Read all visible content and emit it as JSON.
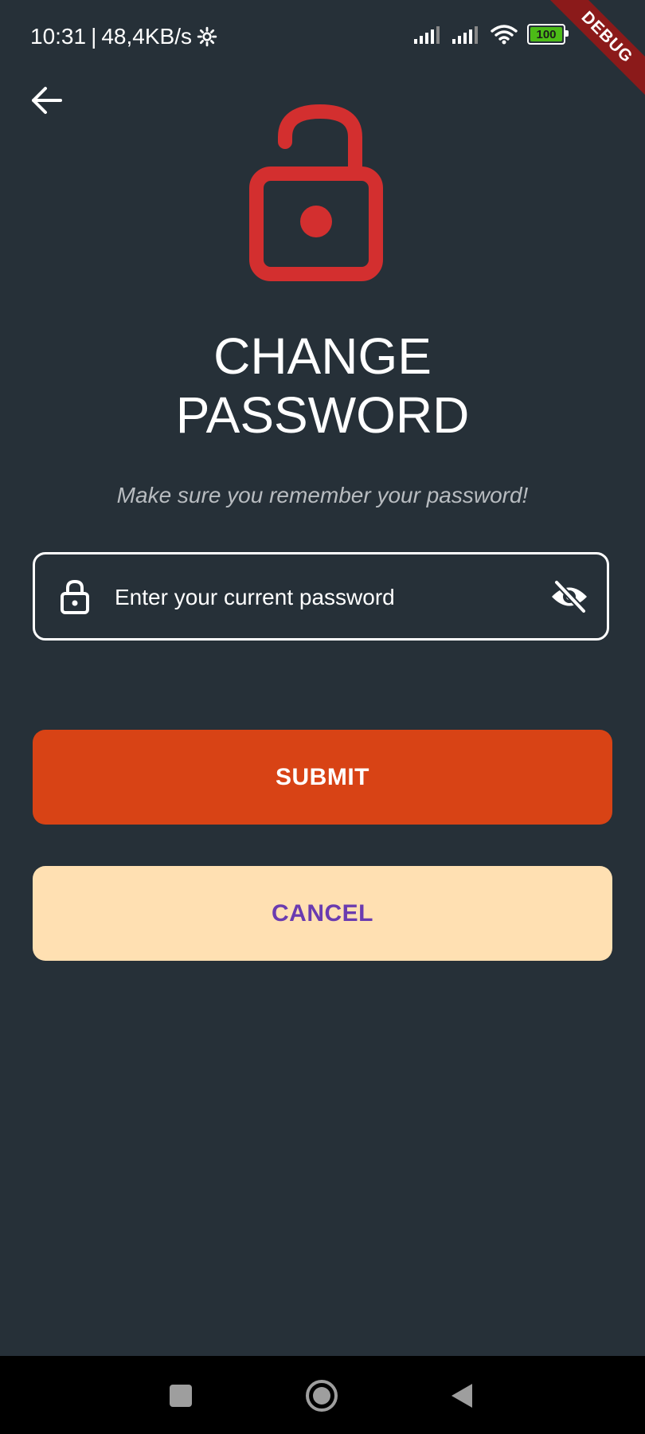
{
  "status_bar": {
    "time": "10:31",
    "separator": "|",
    "network_speed": "48,4KB/s",
    "battery_level": "100",
    "icons": [
      "gear-icon",
      "signal-icon",
      "signal-icon",
      "wifi-icon",
      "battery-icon"
    ]
  },
  "debug_banner": "DEBUG",
  "header": {
    "back_icon": "arrow-back-icon",
    "hero_icon": "lock-open-icon"
  },
  "title_line1": "CHANGE",
  "title_line2": "PASSWORD",
  "subtitle": "Make sure you remember your password!",
  "password_field": {
    "placeholder": "Enter your current password",
    "value": "",
    "leading_icon": "lock-open-icon",
    "trailing_icon": "eye-off-icon"
  },
  "buttons": {
    "submit_label": "SUBMIT",
    "cancel_label": "CANCEL"
  },
  "navigation_bar": {
    "icons": [
      "recents-square-icon",
      "home-circle-icon",
      "back-triangle-icon"
    ]
  },
  "colors": {
    "background": "#263038",
    "accent_red": "#d32f2f",
    "submit_bg": "#d84315",
    "cancel_bg": "#ffe0b2",
    "cancel_text": "#6a3bb0"
  }
}
